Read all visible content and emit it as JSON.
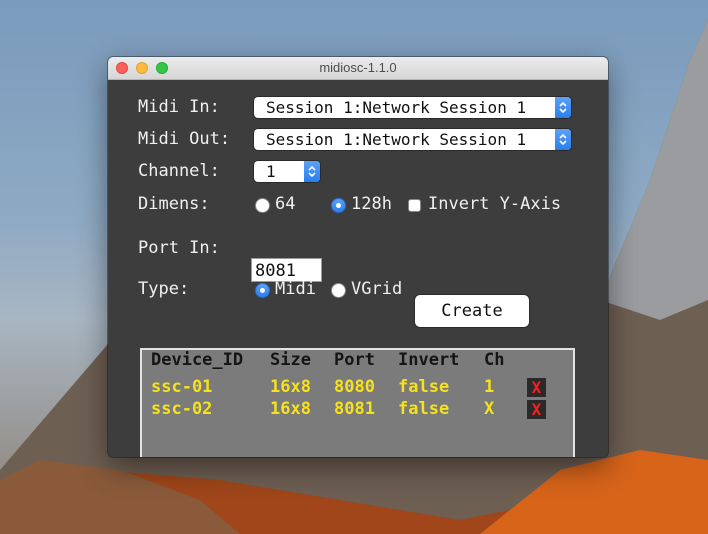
{
  "window": {
    "title": "midiosc-1.1.0"
  },
  "form": {
    "midi_in_label": "Midi In:",
    "midi_in_value": "Session 1:Network Session 1",
    "midi_out_label": "Midi Out:",
    "midi_out_value": "Session 1:Network Session 1",
    "channel_label": "Channel:",
    "channel_value": "1",
    "dimens_label": "Dimens:",
    "dimens_options": [
      "64",
      "128h"
    ],
    "dimens_selected": "128h",
    "invert_label": "Invert Y-Axis",
    "invert_checked": false,
    "port_in_label": "Port In:",
    "port_in_value": "8081",
    "type_label": "Type:",
    "type_options": [
      "Midi",
      "VGrid"
    ],
    "type_selected": "Midi",
    "create_label": "Create"
  },
  "devices": {
    "headers": [
      "Device_ID",
      "Size",
      "Port",
      "Invert",
      "Ch"
    ],
    "rows": [
      {
        "id": "ssc-01",
        "size": "16x8",
        "port": "8080",
        "invert": "false",
        "ch": "1",
        "delete": "X"
      },
      {
        "id": "ssc-02",
        "size": "16x8",
        "port": "8081",
        "invert": "false",
        "ch": "X",
        "delete": "X"
      }
    ]
  },
  "colors": {
    "panel_bg": "#3d3d3d",
    "table_text": "#f5e21c",
    "delete_text": "#ff1d1d",
    "accent": "#2a7ef0"
  }
}
